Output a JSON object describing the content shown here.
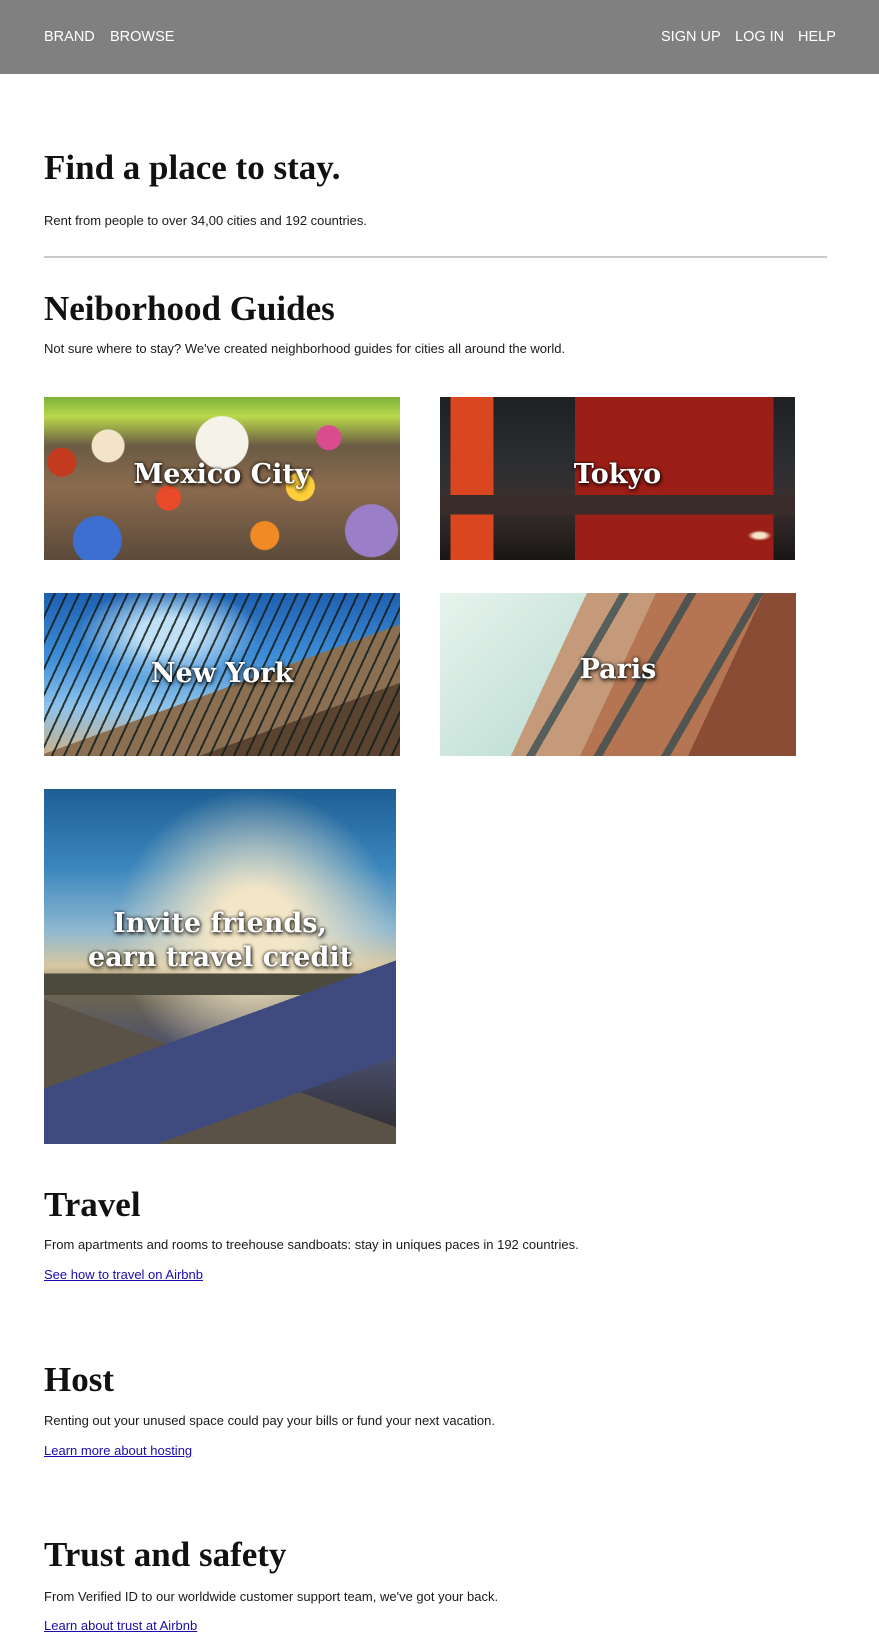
{
  "nav": {
    "left": [
      "BRAND",
      "BROWSE"
    ],
    "right": [
      "SIGN UP",
      "LOG IN",
      "HELP"
    ],
    "background": "#808080"
  },
  "hero": {
    "title": "Find a place to stay.",
    "subtitle": "Rent from people to over 34,00 cities and 192 countries."
  },
  "guides": {
    "title": "Neiborhood Guides",
    "description": "Not sure where to stay? We've created neighborhood guides for cities all around the world.",
    "cards": [
      {
        "label": "Mexico City"
      },
      {
        "label": "Tokyo"
      },
      {
        "label": "New York"
      },
      {
        "label": "Paris"
      }
    ],
    "invite": {
      "label": "Invite friends,\nearn travel credit"
    }
  },
  "travel": {
    "title": "Travel",
    "text": "From apartments and rooms to treehouse sandboats: stay in uniques paces in 192 countries.",
    "link": "See how to travel on Airbnb"
  },
  "host": {
    "title": "Host",
    "text": "Renting out your unused space could pay your bills or fund your next vacation.",
    "link": "Learn more about hosting"
  },
  "trust": {
    "title": "Trust and safety",
    "text": "From Verified ID to our worldwide customer support team, we've got your back.",
    "link": "Learn about trust at Airbnb"
  },
  "colors": {
    "link": "#1a0dab",
    "divider": "#c8c8c8"
  }
}
